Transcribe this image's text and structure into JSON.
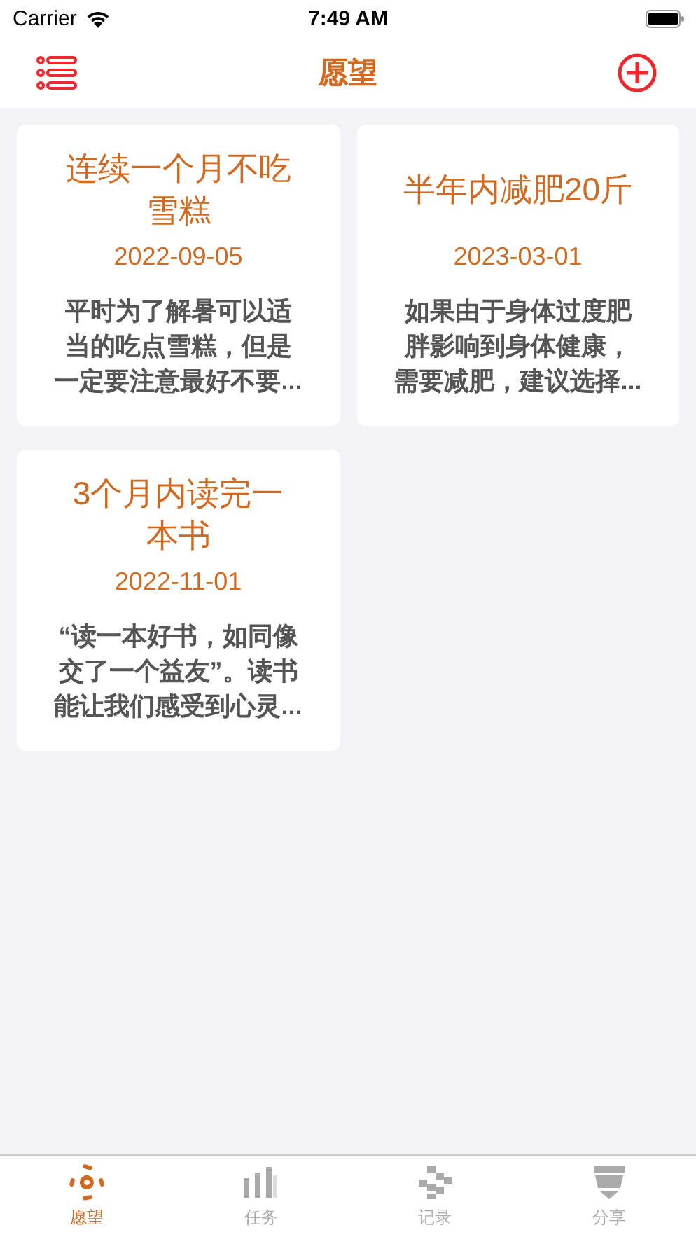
{
  "status_bar": {
    "carrier": "Carrier",
    "time": "7:49 AM"
  },
  "nav": {
    "title": "愿望"
  },
  "wishes": [
    {
      "title": "连续一个月不吃雪糕",
      "date": "2022-09-05",
      "description": "平时为了解暑可以适当的吃点雪糕，但是一定要注意最好不要..."
    },
    {
      "title": "半年内减肥20斤",
      "date": "2023-03-01",
      "description": "如果由于身体过度肥胖影响到身体健康，需要减肥，建议选择..."
    },
    {
      "title": "3个月内读完一本书",
      "date": "2022-11-01",
      "description": "“读一本好书，如同像交了一个益友”。读书能让我们感受到心灵..."
    }
  ],
  "tabs": [
    {
      "label": "愿望",
      "selected": true
    },
    {
      "label": "任务",
      "selected": false
    },
    {
      "label": "记录",
      "selected": false
    },
    {
      "label": "分享",
      "selected": false
    }
  ]
}
